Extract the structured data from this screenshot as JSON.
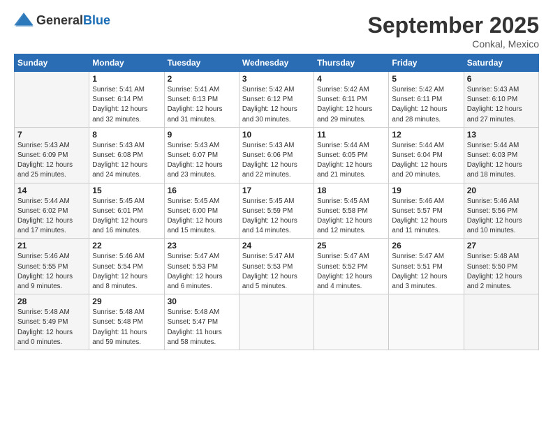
{
  "header": {
    "logo_general": "General",
    "logo_blue": "Blue",
    "month": "September 2025",
    "location": "Conkal, Mexico"
  },
  "weekdays": [
    "Sunday",
    "Monday",
    "Tuesday",
    "Wednesday",
    "Thursday",
    "Friday",
    "Saturday"
  ],
  "weeks": [
    [
      {
        "day": "",
        "info": ""
      },
      {
        "day": "1",
        "info": "Sunrise: 5:41 AM\nSunset: 6:14 PM\nDaylight: 12 hours\nand 32 minutes."
      },
      {
        "day": "2",
        "info": "Sunrise: 5:41 AM\nSunset: 6:13 PM\nDaylight: 12 hours\nand 31 minutes."
      },
      {
        "day": "3",
        "info": "Sunrise: 5:42 AM\nSunset: 6:12 PM\nDaylight: 12 hours\nand 30 minutes."
      },
      {
        "day": "4",
        "info": "Sunrise: 5:42 AM\nSunset: 6:11 PM\nDaylight: 12 hours\nand 29 minutes."
      },
      {
        "day": "5",
        "info": "Sunrise: 5:42 AM\nSunset: 6:11 PM\nDaylight: 12 hours\nand 28 minutes."
      },
      {
        "day": "6",
        "info": "Sunrise: 5:43 AM\nSunset: 6:10 PM\nDaylight: 12 hours\nand 27 minutes."
      }
    ],
    [
      {
        "day": "7",
        "info": "Sunrise: 5:43 AM\nSunset: 6:09 PM\nDaylight: 12 hours\nand 25 minutes."
      },
      {
        "day": "8",
        "info": "Sunrise: 5:43 AM\nSunset: 6:08 PM\nDaylight: 12 hours\nand 24 minutes."
      },
      {
        "day": "9",
        "info": "Sunrise: 5:43 AM\nSunset: 6:07 PM\nDaylight: 12 hours\nand 23 minutes."
      },
      {
        "day": "10",
        "info": "Sunrise: 5:43 AM\nSunset: 6:06 PM\nDaylight: 12 hours\nand 22 minutes."
      },
      {
        "day": "11",
        "info": "Sunrise: 5:44 AM\nSunset: 6:05 PM\nDaylight: 12 hours\nand 21 minutes."
      },
      {
        "day": "12",
        "info": "Sunrise: 5:44 AM\nSunset: 6:04 PM\nDaylight: 12 hours\nand 20 minutes."
      },
      {
        "day": "13",
        "info": "Sunrise: 5:44 AM\nSunset: 6:03 PM\nDaylight: 12 hours\nand 18 minutes."
      }
    ],
    [
      {
        "day": "14",
        "info": "Sunrise: 5:44 AM\nSunset: 6:02 PM\nDaylight: 12 hours\nand 17 minutes."
      },
      {
        "day": "15",
        "info": "Sunrise: 5:45 AM\nSunset: 6:01 PM\nDaylight: 12 hours\nand 16 minutes."
      },
      {
        "day": "16",
        "info": "Sunrise: 5:45 AM\nSunset: 6:00 PM\nDaylight: 12 hours\nand 15 minutes."
      },
      {
        "day": "17",
        "info": "Sunrise: 5:45 AM\nSunset: 5:59 PM\nDaylight: 12 hours\nand 14 minutes."
      },
      {
        "day": "18",
        "info": "Sunrise: 5:45 AM\nSunset: 5:58 PM\nDaylight: 12 hours\nand 12 minutes."
      },
      {
        "day": "19",
        "info": "Sunrise: 5:46 AM\nSunset: 5:57 PM\nDaylight: 12 hours\nand 11 minutes."
      },
      {
        "day": "20",
        "info": "Sunrise: 5:46 AM\nSunset: 5:56 PM\nDaylight: 12 hours\nand 10 minutes."
      }
    ],
    [
      {
        "day": "21",
        "info": "Sunrise: 5:46 AM\nSunset: 5:55 PM\nDaylight: 12 hours\nand 9 minutes."
      },
      {
        "day": "22",
        "info": "Sunrise: 5:46 AM\nSunset: 5:54 PM\nDaylight: 12 hours\nand 8 minutes."
      },
      {
        "day": "23",
        "info": "Sunrise: 5:47 AM\nSunset: 5:53 PM\nDaylight: 12 hours\nand 6 minutes."
      },
      {
        "day": "24",
        "info": "Sunrise: 5:47 AM\nSunset: 5:53 PM\nDaylight: 12 hours\nand 5 minutes."
      },
      {
        "day": "25",
        "info": "Sunrise: 5:47 AM\nSunset: 5:52 PM\nDaylight: 12 hours\nand 4 minutes."
      },
      {
        "day": "26",
        "info": "Sunrise: 5:47 AM\nSunset: 5:51 PM\nDaylight: 12 hours\nand 3 minutes."
      },
      {
        "day": "27",
        "info": "Sunrise: 5:48 AM\nSunset: 5:50 PM\nDaylight: 12 hours\nand 2 minutes."
      }
    ],
    [
      {
        "day": "28",
        "info": "Sunrise: 5:48 AM\nSunset: 5:49 PM\nDaylight: 12 hours\nand 0 minutes."
      },
      {
        "day": "29",
        "info": "Sunrise: 5:48 AM\nSunset: 5:48 PM\nDaylight: 11 hours\nand 59 minutes."
      },
      {
        "day": "30",
        "info": "Sunrise: 5:48 AM\nSunset: 5:47 PM\nDaylight: 11 hours\nand 58 minutes."
      },
      {
        "day": "",
        "info": ""
      },
      {
        "day": "",
        "info": ""
      },
      {
        "day": "",
        "info": ""
      },
      {
        "day": "",
        "info": ""
      }
    ]
  ]
}
